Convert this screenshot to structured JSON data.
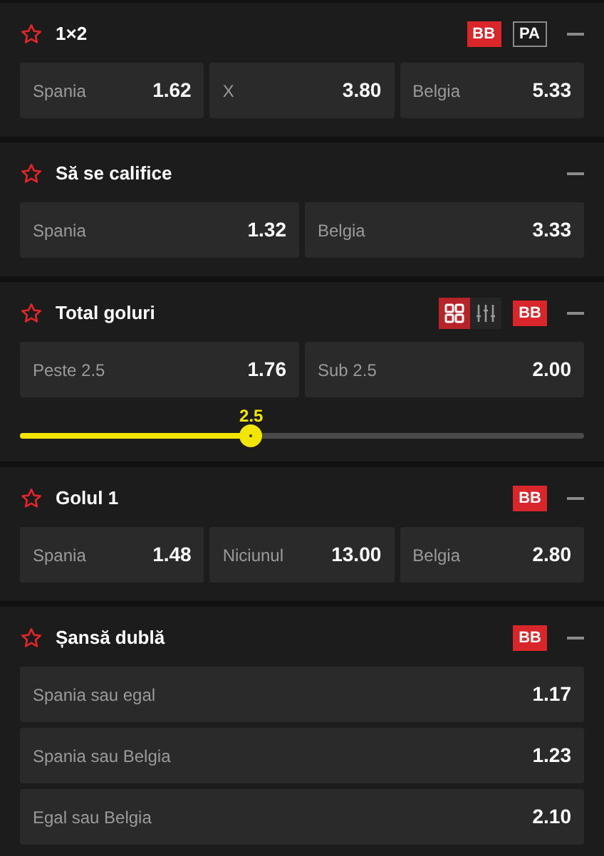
{
  "markets": [
    {
      "title": "1×2",
      "badges": [
        {
          "text": "BB",
          "kind": "filled"
        },
        {
          "text": "PA",
          "kind": "outlined"
        }
      ],
      "kind": "grid",
      "outcomes": [
        {
          "label": "Spania",
          "odds": "1.62"
        },
        {
          "label": "X",
          "odds": "3.80"
        },
        {
          "label": "Belgia",
          "odds": "5.33"
        }
      ]
    },
    {
      "title": "Să se califice",
      "kind": "grid",
      "outcomes": [
        {
          "label": "Spania",
          "odds": "1.32"
        },
        {
          "label": "Belgia",
          "odds": "3.33"
        }
      ]
    },
    {
      "title": "Total goluri",
      "view_toggle": [
        {
          "kind": "grid",
          "selected": true
        },
        {
          "kind": "sliders",
          "selected": false
        }
      ],
      "badges": [
        {
          "text": "BB",
          "kind": "filled"
        }
      ],
      "kind": "grid",
      "outcomes": [
        {
          "label": "Peste 2.5",
          "odds": "1.76"
        },
        {
          "label": "Sub 2.5",
          "odds": "2.00"
        }
      ],
      "slider": {
        "reading": "2.5",
        "level": 0.41
      }
    },
    {
      "title": "Golul 1",
      "badges": [
        {
          "text": "BB",
          "kind": "filled"
        }
      ],
      "kind": "grid",
      "outcomes": [
        {
          "label": "Spania",
          "odds": "1.48"
        },
        {
          "label": "Niciunul",
          "odds": "13.00"
        },
        {
          "label": "Belgia",
          "odds": "2.80"
        }
      ]
    },
    {
      "title": "Șansă dublă",
      "badges": [
        {
          "text": "BB",
          "kind": "filled"
        }
      ],
      "kind": "list",
      "outcomes": [
        {
          "label": "Spania sau egal",
          "odds": "1.17"
        },
        {
          "label": "Spania sau Belgia",
          "odds": "1.23"
        },
        {
          "label": "Egal sau Belgia",
          "odds": "2.10"
        }
      ]
    }
  ]
}
